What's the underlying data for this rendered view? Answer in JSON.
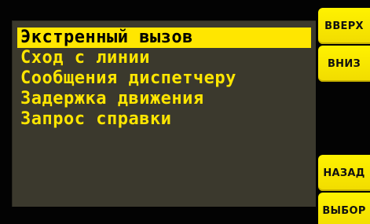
{
  "menu": {
    "items": [
      {
        "label": "Экстренный вызов",
        "selected": true
      },
      {
        "label": "Сход с линии",
        "selected": false
      },
      {
        "label": "Сообщения диспетчеру",
        "selected": false
      },
      {
        "label": "Задержка движения",
        "selected": false
      },
      {
        "label": "Запрос справки",
        "selected": false
      }
    ]
  },
  "buttons": {
    "up": "ВВЕРХ",
    "down": "ВНИЗ",
    "back": "НАЗАД",
    "select": "ВЫБОР"
  },
  "colors": {
    "accent": "#ffe600",
    "panel": "#3b392d",
    "background": "#000000"
  }
}
